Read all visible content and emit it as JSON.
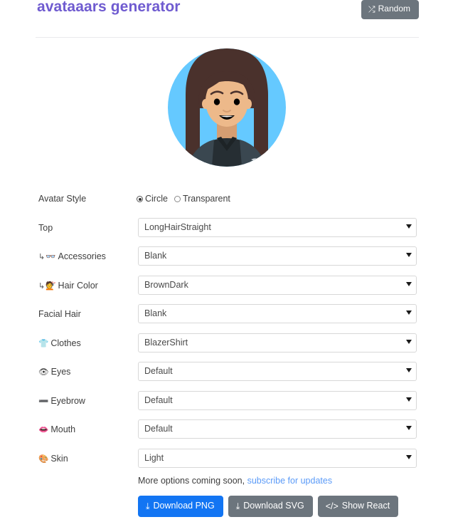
{
  "header": {
    "title": "avataaars generator",
    "random_button": {
      "label": "Random",
      "icon": "shuffle-icon",
      "glyph": "⤮"
    }
  },
  "avatar": {
    "background_color": "#65C9FF",
    "skin_color": "#EDB98A",
    "hair_color": "#4A312C",
    "clothes_color": "#262E33",
    "shadow_color": "#3A4750",
    "mouth_color": "#000000",
    "eye_color": "#000000"
  },
  "form": {
    "rows": [
      {
        "label": "Avatar Style",
        "indent": false,
        "glyph": "",
        "icon": "",
        "type": "radio",
        "options": [
          "Circle",
          "Transparent"
        ],
        "value": "Circle"
      },
      {
        "label": "Top",
        "indent": false,
        "glyph": "",
        "icon": "",
        "type": "select",
        "value": "LongHairStraight"
      },
      {
        "label": "Accessories",
        "indent": true,
        "glyph": "👓",
        "icon": "glasses-icon",
        "type": "select",
        "value": "Blank"
      },
      {
        "label": "Hair Color",
        "indent": true,
        "glyph": "💇",
        "icon": "haircut-icon",
        "type": "select",
        "value": "BrownDark"
      },
      {
        "label": "Facial Hair",
        "indent": false,
        "glyph": "",
        "icon": "",
        "type": "select",
        "value": "Blank"
      },
      {
        "label": "Clothes",
        "indent": false,
        "glyph": "👕",
        "icon": "tshirt-icon",
        "type": "select",
        "value": "BlazerShirt"
      },
      {
        "label": "Eyes",
        "indent": false,
        "glyph": "👁",
        "icon": "eye-icon",
        "type": "select",
        "value": "Default"
      },
      {
        "label": "Eyebrow",
        "indent": false,
        "glyph": "➖",
        "icon": "eyebrow-icon",
        "type": "select",
        "value": "Default"
      },
      {
        "label": "Mouth",
        "indent": false,
        "glyph": "👄",
        "icon": "mouth-icon",
        "type": "select",
        "value": "Default"
      },
      {
        "label": "Skin",
        "indent": false,
        "glyph": "🎨",
        "icon": "palette-icon",
        "type": "select",
        "value": "Light"
      }
    ],
    "indent_marker": "↳"
  },
  "footer": {
    "note_text": "More options coming soon, ",
    "note_link": "subscribe for updates",
    "buttons": [
      {
        "label": "Download PNG",
        "icon": "download-icon",
        "glyph": "⤓",
        "style": "primary"
      },
      {
        "label": "Download SVG",
        "icon": "download-icon",
        "glyph": "⤓",
        "style": "secondary"
      },
      {
        "label": "Show React",
        "icon": "code-icon",
        "glyph": "</>",
        "style": "secondary"
      }
    ]
  }
}
